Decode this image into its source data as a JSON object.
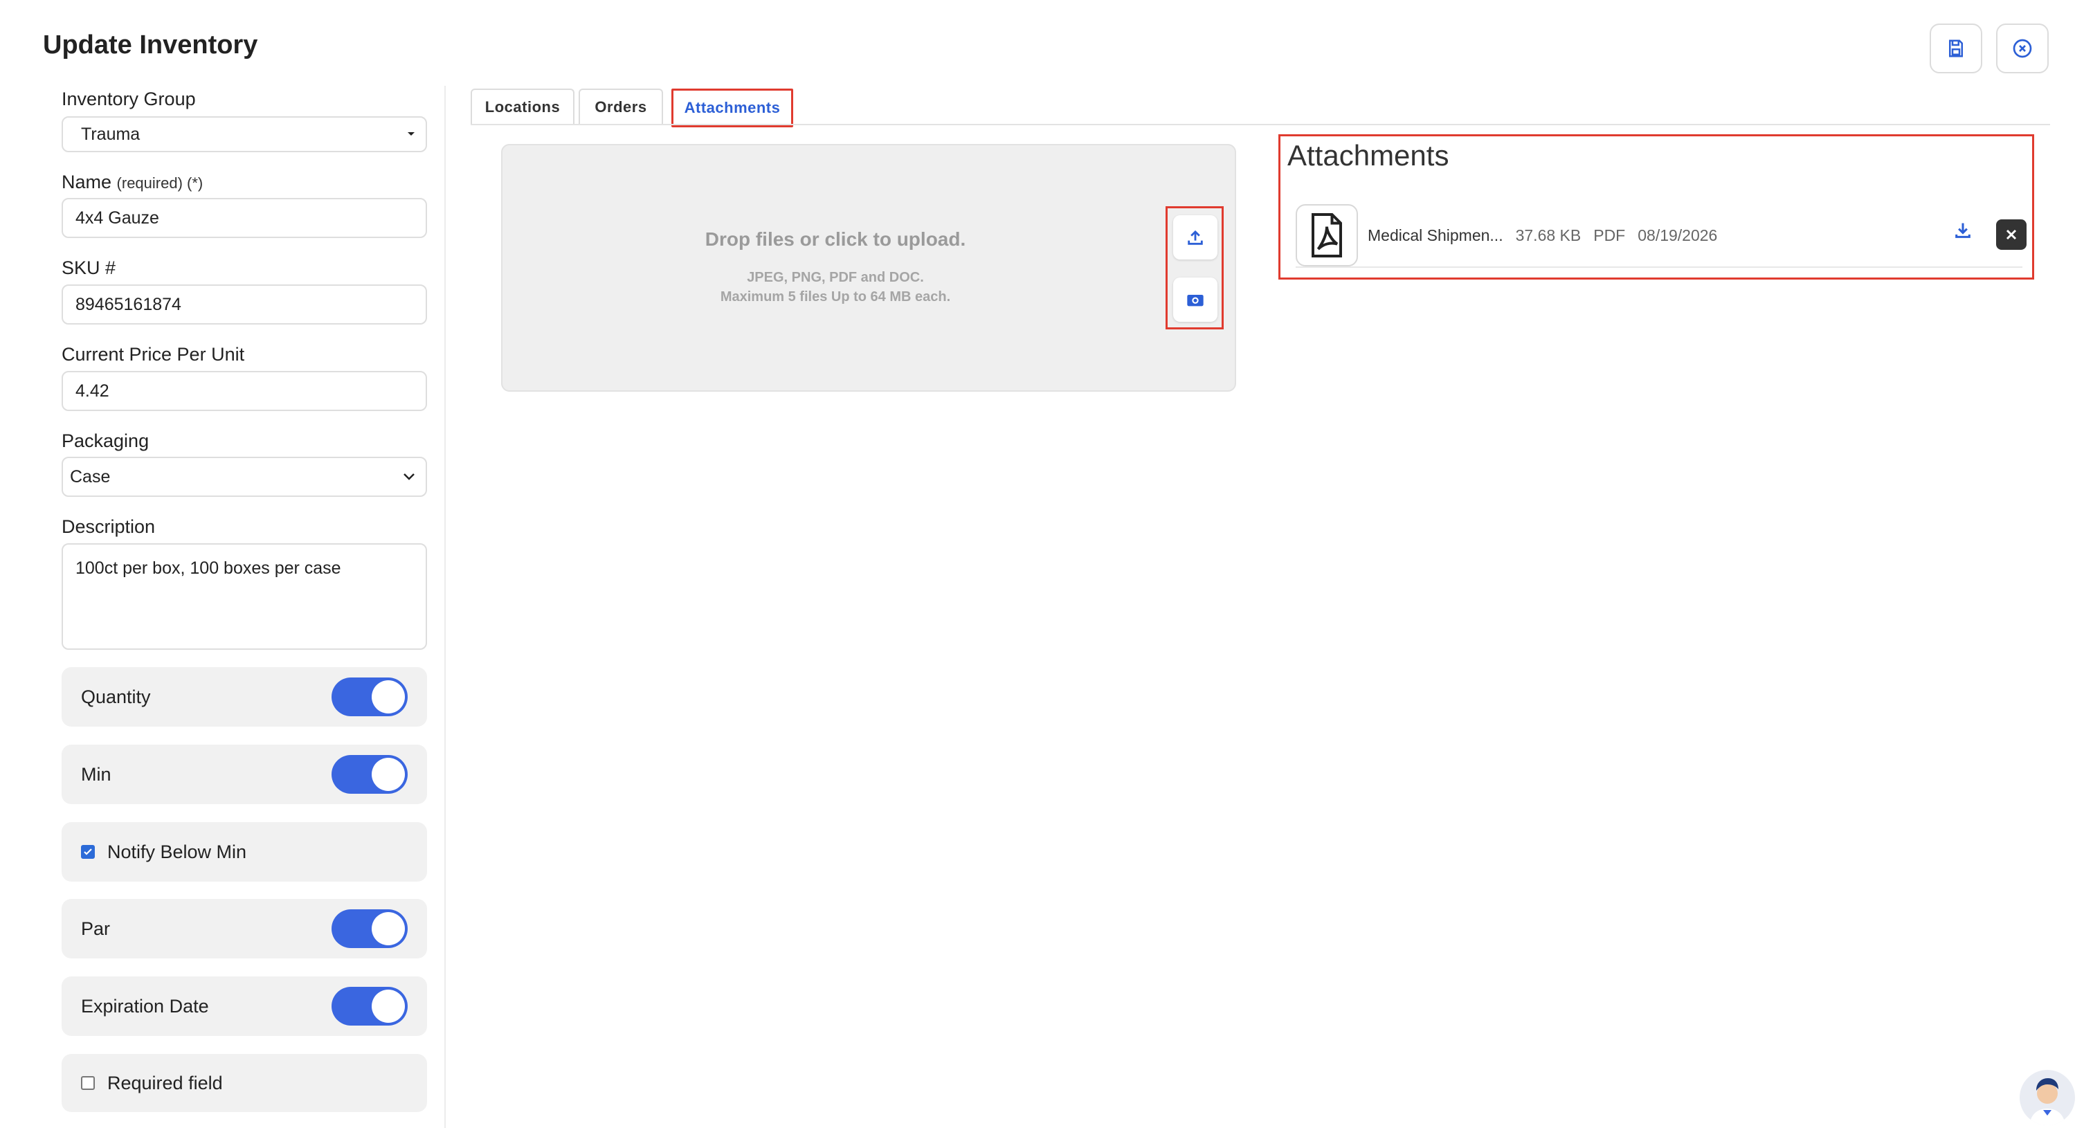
{
  "page": {
    "title": "Update Inventory"
  },
  "header": {
    "save_icon": "save-icon",
    "close_icon": "close-circle-icon"
  },
  "form": {
    "inventory_group": {
      "label": "Inventory Group",
      "value": "Trauma"
    },
    "name": {
      "label": "Name",
      "required_note": "(required) (*)",
      "value": "4x4 Gauze"
    },
    "sku": {
      "label": "SKU #",
      "value": "89465161874"
    },
    "price": {
      "label": "Current Price Per Unit",
      "value": "4.42"
    },
    "packaging": {
      "label": "Packaging",
      "value": "Case"
    },
    "description": {
      "label": "Description",
      "value": "100ct per box, 100 boxes per case"
    }
  },
  "options": {
    "quantity": {
      "label": "Quantity",
      "on": true
    },
    "min": {
      "label": "Min",
      "on": true
    },
    "notify_below_min": {
      "label": "Notify Below Min",
      "checked": true
    },
    "par": {
      "label": "Par",
      "on": true
    },
    "expiration_date": {
      "label": "Expiration Date",
      "on": true
    },
    "required_field": {
      "label": "Required field",
      "checked": false
    }
  },
  "tabs": [
    {
      "label": "Locations"
    },
    {
      "label": "Orders"
    },
    {
      "label": "Attachments",
      "active": true
    }
  ],
  "upload": {
    "title": "Drop files or click to upload.",
    "formats": "JPEG, PNG, PDF and DOC.",
    "limits": "Maximum 5 files Up to 64 MB each."
  },
  "attachments": {
    "heading": "Attachments",
    "files": [
      {
        "name": "Medical Shipmen...",
        "size": "37.68 KB",
        "type": "PDF",
        "date": "08/19/2026"
      }
    ]
  },
  "colors": {
    "accent": "#3a66e0",
    "highlight": "#e03b2f"
  }
}
